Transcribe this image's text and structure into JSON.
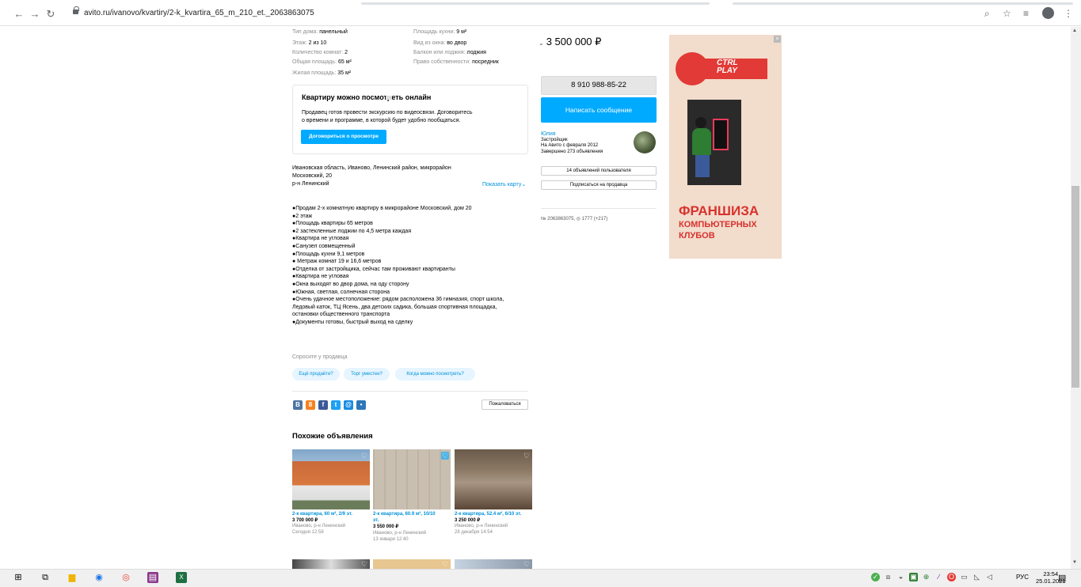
{
  "browser": {
    "url": "avito.ru/ivanovo/kvartiry/2-k_kvartira_65_m_210_et._2063863075"
  },
  "params": [
    {
      "label": "Тип дома: ",
      "value": "панельный"
    },
    {
      "label": "Этаж: ",
      "value": "2 из 10"
    },
    {
      "label": "Количество комнат: ",
      "value": "2"
    },
    {
      "label": "Общая площадь: ",
      "value": "65 м²"
    },
    {
      "label": "Жилая площадь: ",
      "value": "35 м²"
    },
    {
      "label": "Площадь кухни: ",
      "value": "9 м²"
    },
    {
      "label": "Вид из окна: ",
      "value": "во двор"
    },
    {
      "label": "Балкон или лоджия: ",
      "value": "лоджия"
    },
    {
      "label": "Право собственности: ",
      "value": "посредник"
    }
  ],
  "video": {
    "title": "Квартиру можно посмотреть онлайн",
    "line1": "Продавец готов провести экскурсию по видеосвязи. Договоритесь",
    "line2": "о времени и программе, в которой будет удобно пообщаться.",
    "button": "Договориться о просмотре"
  },
  "address": {
    "line1": "Ивановская область, Иваново, Ленинский район, микрорайон",
    "line2": "Московский, 20",
    "district": "р-н Ленинский",
    "show_map": "Показать карту"
  },
  "description": [
    "●Продам 2-х комнатную квартиру в микрорайоне Московский, дом 20",
    "●2 этаж",
    "●Площадь квартиры 65 метров",
    "●2 застекленные лоджии по 4,5 метра каждая",
    "●Квартира не угловая",
    "●Санузел совмещенный",
    "●Площадь кухни 9,1 метров",
    "● Метраж комнат 19 и 16,6 метров",
    "●Отделка от застройщика, сейчас там проживают квартиранты",
    "●Квартира не угловая",
    "●Окна выходят во двор дома, на оду сторону",
    "●Южная, светлая, солнечная сторона",
    "●Очень удачное местоположение: рядом расположена 36 гимназия, спорт школа,",
    "Ледовый каток, ТЦ Ясень, два детских садика, большая спортивная площадка,",
    "остановки общественного транспорта",
    "●Документы готовы, быстрый выход на сделку"
  ],
  "ask": {
    "label": "Спросите у продавца",
    "chips": [
      "Ещё продаёте?",
      "Торг уместен?",
      "Когда можно посмотреть?"
    ]
  },
  "share": [
    "B",
    "8",
    "f",
    "t",
    "@",
    "•"
  ],
  "complain": "Пожаловаться",
  "similar": {
    "title": "Похожие объявления",
    "cards": [
      {
        "title": "2-к квартира, 60 м², 2/9 эт.",
        "price": "3 700 000 ₽",
        "place": "Иваново, р-н Ленинский",
        "date": "Сегодня 12:58"
      },
      {
        "title1": "2-к квартира, 60.9 м², 10/10",
        "title2": "эт.",
        "price": "3 550 000 ₽",
        "place": "Иваново, р-н Ленинский",
        "date": "13 января 12:40"
      },
      {
        "title": "2-к квартира, 52.4 м², 6/10 эт.",
        "price": "3 250 000 ₽",
        "place": "Иваново, р-н Ленинский",
        "date": "28 декабря 14:54"
      }
    ]
  },
  "sidebar": {
    "price": "3 500 000 ₽",
    "phone": "8 910 988-85-22",
    "message": "Написать сообщение",
    "seller_name": "Юлия",
    "seller_type": "Застройщик",
    "seller_since": "На Авито с февраля 2012",
    "seller_done": "Завершено 273 объявления",
    "listings_btn": "14 объявлений пользователя",
    "subscribe_btn": "Подписаться на продавца",
    "stats": "№ 2063863075, ◎ 1777 (+217)"
  },
  "ad": {
    "logo1": "CTRL",
    "logo2": "PLAY",
    "line1": "ФРАНШИЗА",
    "line2": "КОМПЬЮТЕРНЫХ",
    "line3": "КЛУБОВ"
  },
  "taskbar": {
    "lang": "РУС",
    "time": "23:54",
    "date": "25.01.2021"
  },
  "colors": {
    "accent": "#00aaff",
    "link": "#0091d9",
    "ad_red": "#d8322e"
  }
}
